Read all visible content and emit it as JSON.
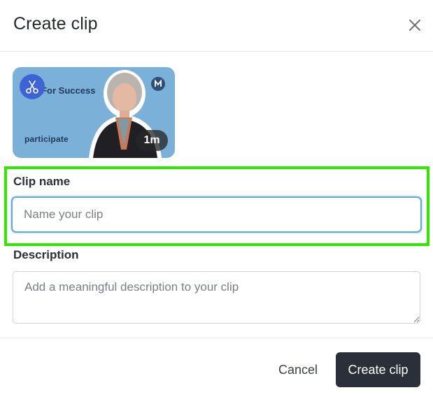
{
  "dialog": {
    "title": "Create clip",
    "close_icon": "close-icon"
  },
  "thumbnail": {
    "bg_text": "ion For Success",
    "brand": "participate",
    "duration": "1m",
    "scissors_icon": "scissors-icon",
    "logo_icon": "channel-logo-icon"
  },
  "form": {
    "clip_name_label": "Clip name",
    "clip_name_placeholder": "Name your clip",
    "clip_name_value": "",
    "description_label": "Description",
    "description_placeholder": "Add a meaningful description to your clip",
    "description_value": ""
  },
  "actions": {
    "cancel_label": "Cancel",
    "create_label": "Create clip"
  },
  "colors": {
    "highlight": "#33e600",
    "primary_button": "#2b2f3a",
    "input_focus": "#5da7e0",
    "scissors_badge": "#3d63d4"
  }
}
